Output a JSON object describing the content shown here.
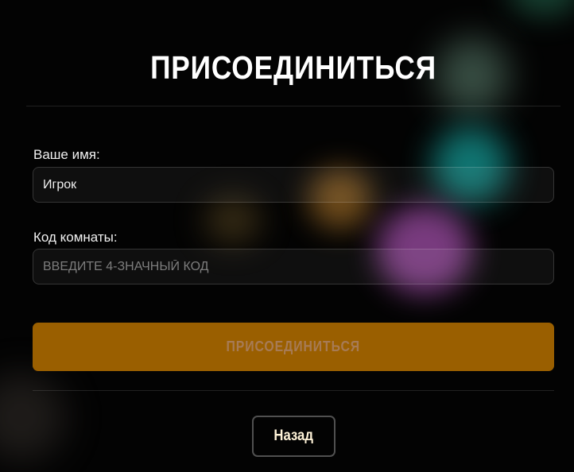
{
  "screen": {
    "title": "ПРИСОЕДИНИТЬСЯ"
  },
  "form": {
    "name_label": "Ваше имя:",
    "name_value": "Игрок",
    "code_label": "Код комнаты:",
    "code_placeholder": "ВВЕДИТЕ 4-ЗНАЧНЫЙ КОД",
    "code_value": ""
  },
  "actions": {
    "join_label": "ПРИСОЕДИНИТЬСЯ",
    "back_label": "Назад"
  },
  "colors": {
    "background": "#030303",
    "accent": "#9a5f00",
    "title_text": "#ffffff",
    "muted_button_text": "#a77b55"
  }
}
